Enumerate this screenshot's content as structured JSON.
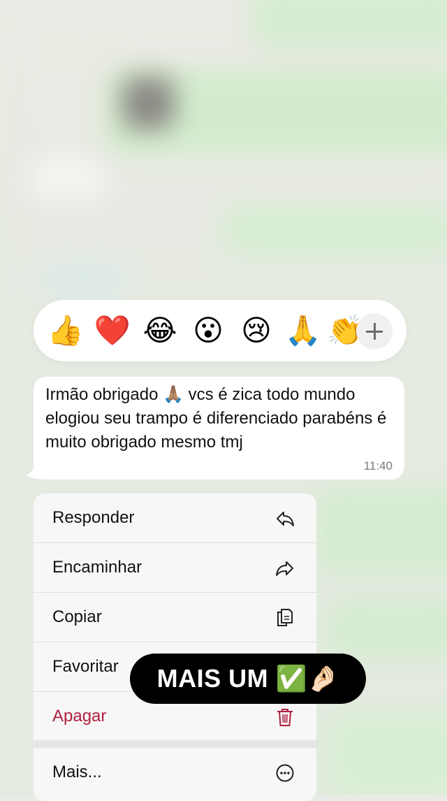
{
  "reactions": {
    "emojis": [
      "👍",
      "❤️",
      "😂",
      "😮",
      "😢",
      "🙏",
      "👏"
    ],
    "more_label": "+"
  },
  "message": {
    "text": "Irmão obrigado 🙏🏽 vcs é zica todo mundo elogiou seu trampo é diferenciado parabéns é muito obrigado mesmo tmj",
    "time": "11:40"
  },
  "menu": {
    "items": [
      {
        "label": "Responder",
        "icon": "reply-icon"
      },
      {
        "label": "Encaminhar",
        "icon": "forward-icon"
      },
      {
        "label": "Copiar",
        "icon": "copy-icon"
      },
      {
        "label": "Favoritar",
        "icon": "star-icon"
      },
      {
        "label": "Apagar",
        "icon": "trash-icon"
      },
      {
        "label": "Mais...",
        "icon": "more-icon"
      }
    ],
    "danger_color": "#b0203f"
  },
  "sticker": {
    "text": "MAIS UM ✅🤌🏻"
  }
}
